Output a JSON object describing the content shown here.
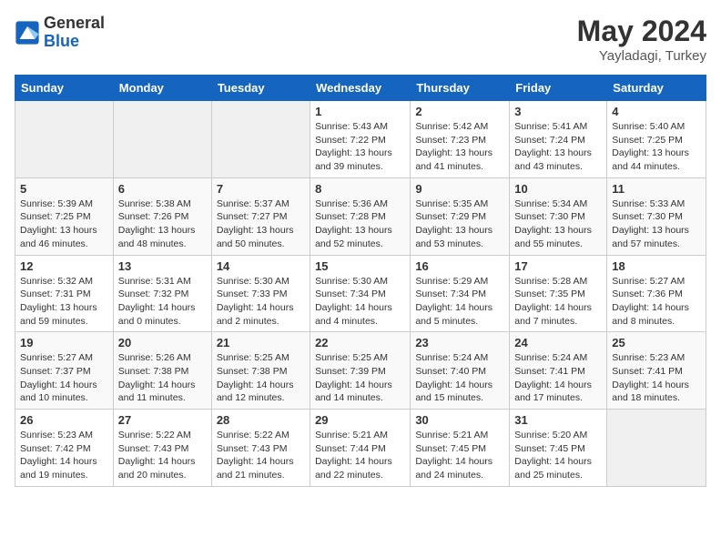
{
  "header": {
    "logo_general": "General",
    "logo_blue": "Blue",
    "month_year": "May 2024",
    "location": "Yayladagi, Turkey"
  },
  "days_of_week": [
    "Sunday",
    "Monday",
    "Tuesday",
    "Wednesday",
    "Thursday",
    "Friday",
    "Saturday"
  ],
  "weeks": [
    [
      {
        "day": "",
        "empty": true
      },
      {
        "day": "",
        "empty": true
      },
      {
        "day": "",
        "empty": true
      },
      {
        "day": "1",
        "sunrise": "5:43 AM",
        "sunset": "7:22 PM",
        "daylight": "13 hours and 39 minutes."
      },
      {
        "day": "2",
        "sunrise": "5:42 AM",
        "sunset": "7:23 PM",
        "daylight": "13 hours and 41 minutes."
      },
      {
        "day": "3",
        "sunrise": "5:41 AM",
        "sunset": "7:24 PM",
        "daylight": "13 hours and 43 minutes."
      },
      {
        "day": "4",
        "sunrise": "5:40 AM",
        "sunset": "7:25 PM",
        "daylight": "13 hours and 44 minutes."
      }
    ],
    [
      {
        "day": "5",
        "sunrise": "5:39 AM",
        "sunset": "7:25 PM",
        "daylight": "13 hours and 46 minutes."
      },
      {
        "day": "6",
        "sunrise": "5:38 AM",
        "sunset": "7:26 PM",
        "daylight": "13 hours and 48 minutes."
      },
      {
        "day": "7",
        "sunrise": "5:37 AM",
        "sunset": "7:27 PM",
        "daylight": "13 hours and 50 minutes."
      },
      {
        "day": "8",
        "sunrise": "5:36 AM",
        "sunset": "7:28 PM",
        "daylight": "13 hours and 52 minutes."
      },
      {
        "day": "9",
        "sunrise": "5:35 AM",
        "sunset": "7:29 PM",
        "daylight": "13 hours and 53 minutes."
      },
      {
        "day": "10",
        "sunrise": "5:34 AM",
        "sunset": "7:30 PM",
        "daylight": "13 hours and 55 minutes."
      },
      {
        "day": "11",
        "sunrise": "5:33 AM",
        "sunset": "7:30 PM",
        "daylight": "13 hours and 57 minutes."
      }
    ],
    [
      {
        "day": "12",
        "sunrise": "5:32 AM",
        "sunset": "7:31 PM",
        "daylight": "13 hours and 59 minutes."
      },
      {
        "day": "13",
        "sunrise": "5:31 AM",
        "sunset": "7:32 PM",
        "daylight": "14 hours and 0 minutes."
      },
      {
        "day": "14",
        "sunrise": "5:30 AM",
        "sunset": "7:33 PM",
        "daylight": "14 hours and 2 minutes."
      },
      {
        "day": "15",
        "sunrise": "5:30 AM",
        "sunset": "7:34 PM",
        "daylight": "14 hours and 4 minutes."
      },
      {
        "day": "16",
        "sunrise": "5:29 AM",
        "sunset": "7:34 PM",
        "daylight": "14 hours and 5 minutes."
      },
      {
        "day": "17",
        "sunrise": "5:28 AM",
        "sunset": "7:35 PM",
        "daylight": "14 hours and 7 minutes."
      },
      {
        "day": "18",
        "sunrise": "5:27 AM",
        "sunset": "7:36 PM",
        "daylight": "14 hours and 8 minutes."
      }
    ],
    [
      {
        "day": "19",
        "sunrise": "5:27 AM",
        "sunset": "7:37 PM",
        "daylight": "14 hours and 10 minutes."
      },
      {
        "day": "20",
        "sunrise": "5:26 AM",
        "sunset": "7:38 PM",
        "daylight": "14 hours and 11 minutes."
      },
      {
        "day": "21",
        "sunrise": "5:25 AM",
        "sunset": "7:38 PM",
        "daylight": "14 hours and 12 minutes."
      },
      {
        "day": "22",
        "sunrise": "5:25 AM",
        "sunset": "7:39 PM",
        "daylight": "14 hours and 14 minutes."
      },
      {
        "day": "23",
        "sunrise": "5:24 AM",
        "sunset": "7:40 PM",
        "daylight": "14 hours and 15 minutes."
      },
      {
        "day": "24",
        "sunrise": "5:24 AM",
        "sunset": "7:41 PM",
        "daylight": "14 hours and 17 minutes."
      },
      {
        "day": "25",
        "sunrise": "5:23 AM",
        "sunset": "7:41 PM",
        "daylight": "14 hours and 18 minutes."
      }
    ],
    [
      {
        "day": "26",
        "sunrise": "5:23 AM",
        "sunset": "7:42 PM",
        "daylight": "14 hours and 19 minutes."
      },
      {
        "day": "27",
        "sunrise": "5:22 AM",
        "sunset": "7:43 PM",
        "daylight": "14 hours and 20 minutes."
      },
      {
        "day": "28",
        "sunrise": "5:22 AM",
        "sunset": "7:43 PM",
        "daylight": "14 hours and 21 minutes."
      },
      {
        "day": "29",
        "sunrise": "5:21 AM",
        "sunset": "7:44 PM",
        "daylight": "14 hours and 22 minutes."
      },
      {
        "day": "30",
        "sunrise": "5:21 AM",
        "sunset": "7:45 PM",
        "daylight": "14 hours and 24 minutes."
      },
      {
        "day": "31",
        "sunrise": "5:20 AM",
        "sunset": "7:45 PM",
        "daylight": "14 hours and 25 minutes."
      },
      {
        "day": "",
        "empty": true
      }
    ]
  ]
}
